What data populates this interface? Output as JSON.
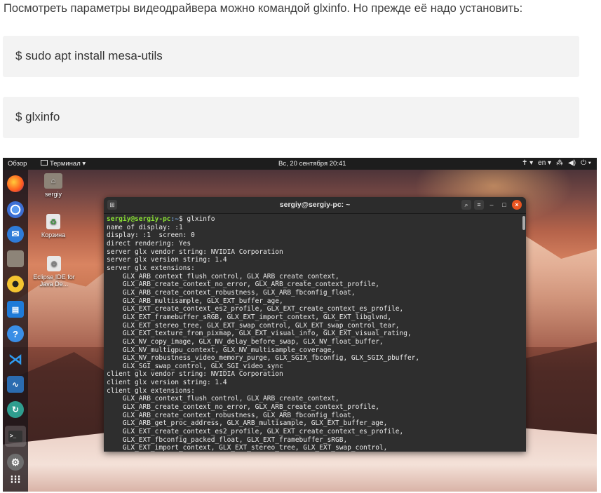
{
  "article": {
    "intro": "Посмотреть параметры видеодрайвера можно командой glxinfo. Но прежде её надо установить:",
    "commands": [
      "$ sudo apt install mesa-utils",
      "$ glxinfo"
    ]
  },
  "desktop": {
    "topbar": {
      "overview": "Обзор",
      "app_menu": "Терминал ▾",
      "clock": "Вс, 20 сентября  20:41",
      "accessibility": "✝ ▾",
      "lang": "en ▾",
      "network": "⁂",
      "volume": "◀)",
      "power": "⏻ ▾"
    },
    "dock": [
      {
        "icon": "firefox-icon"
      },
      {
        "icon": "chromium-icon"
      },
      {
        "icon": "thunderbird-icon"
      },
      {
        "icon": "files-icon"
      },
      {
        "icon": "rhythmbox-icon"
      },
      {
        "icon": "libreoffice-writer-icon"
      },
      {
        "icon": "help-icon"
      },
      {
        "icon": "vscode-icon"
      },
      {
        "icon": "system-monitor-icon"
      },
      {
        "icon": "software-updater-icon"
      },
      {
        "icon": "terminal-icon"
      },
      {
        "icon": "settings-icon"
      },
      {
        "icon": "show-apps-icon"
      }
    ],
    "desktop_icons": [
      {
        "label": "sergiy",
        "icon": "home-folder-icon"
      },
      {
        "label": "Корзина",
        "icon": "trash-icon"
      },
      {
        "label": "Eclipse IDE for Java De...",
        "icon": "eclipse-icon"
      }
    ],
    "terminal": {
      "title": "sergiy@sergiy-pc: ~",
      "prompt_user": "sergiy@sergiy-pc",
      "prompt_path": ":~",
      "command": "$ glxinfo",
      "lines": [
        "name of display: :1",
        "display: :1  screen: 0",
        "direct rendering: Yes",
        "server glx vendor string: NVIDIA Corporation",
        "server glx version string: 1.4",
        "server glx extensions:",
        "    GLX_ARB_context_flush_control, GLX_ARB_create_context,",
        "    GLX_ARB_create_context_no_error, GLX_ARB_create_context_profile,",
        "    GLX_ARB_create_context_robustness, GLX_ARB_fbconfig_float,",
        "    GLX_ARB_multisample, GLX_EXT_buffer_age,",
        "    GLX_EXT_create_context_es2_profile, GLX_EXT_create_context_es_profile,",
        "    GLX_EXT_framebuffer_sRGB, GLX_EXT_import_context, GLX_EXT_libglvnd,",
        "    GLX_EXT_stereo_tree, GLX_EXT_swap_control, GLX_EXT_swap_control_tear,",
        "    GLX_EXT_texture_from_pixmap, GLX_EXT_visual_info, GLX_EXT_visual_rating,",
        "    GLX_NV_copy_image, GLX_NV_delay_before_swap, GLX_NV_float_buffer,",
        "    GLX_NV_multigpu_context, GLX_NV_multisample_coverage,",
        "    GLX_NV_robustness_video_memory_purge, GLX_SGIX_fbconfig, GLX_SGIX_pbuffer,",
        "    GLX_SGI_swap_control, GLX_SGI_video_sync",
        "client glx vendor string: NVIDIA Corporation",
        "client glx version string: 1.4",
        "client glx extensions:",
        "    GLX_ARB_context_flush_control, GLX_ARB_create_context,",
        "    GLX_ARB_create_context_no_error, GLX_ARB_create_context_profile,",
        "    GLX_ARB_create_context_robustness, GLX_ARB_fbconfig_float,",
        "    GLX_ARB_get_proc_address, GLX_ARB_multisample, GLX_EXT_buffer_age,",
        "    GLX_EXT_create_context_es2_profile, GLX_EXT_create_context_es_profile,",
        "    GLX_EXT_fbconfig_packed_float, GLX_EXT_framebuffer_sRGB,",
        "    GLX_EXT_import_context, GLX_EXT_stereo_tree, GLX_EXT_swap_control,"
      ]
    }
  },
  "colors": {
    "accent_close": "#e95420",
    "prompt_user": "#8ae234",
    "prompt_path": "#729fcf"
  }
}
